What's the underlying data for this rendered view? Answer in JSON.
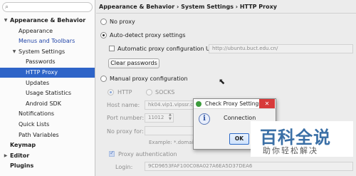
{
  "sidebar": {
    "search_placeholder": "",
    "items": [
      {
        "label": "Appearance & Behavior",
        "level": 0,
        "bold": true,
        "expanded": true
      },
      {
        "label": "Appearance",
        "level": 1
      },
      {
        "label": "Menus and Toolbars",
        "level": 1,
        "link": true
      },
      {
        "label": "System Settings",
        "level": 1,
        "expanded": true
      },
      {
        "label": "Passwords",
        "level": 2
      },
      {
        "label": "HTTP Proxy",
        "level": 2,
        "selected": true
      },
      {
        "label": "Updates",
        "level": 2
      },
      {
        "label": "Usage Statistics",
        "level": 2
      },
      {
        "label": "Android SDK",
        "level": 2
      },
      {
        "label": "Notifications",
        "level": 1
      },
      {
        "label": "Quick Lists",
        "level": 1
      },
      {
        "label": "Path Variables",
        "level": 1
      },
      {
        "label": "Keymap",
        "level": 0,
        "bold": true
      },
      {
        "label": "Editor",
        "level": 0,
        "bold": true,
        "collapsed": true
      },
      {
        "label": "Plugins",
        "level": 0,
        "bold": true
      }
    ]
  },
  "content": {
    "breadcrumb": "Appearance & Behavior › System Settings › HTTP Proxy",
    "no_proxy": "No proxy",
    "auto_detect": "Auto-detect proxy settings",
    "auto_config_label": "Automatic proxy configuration URL:",
    "auto_config_value": "http://ubuntu.buct.edu.cn/",
    "clear_passwords": "Clear passwords",
    "manual": "Manual proxy configuration",
    "http": "HTTP",
    "socks": "SOCKS",
    "host_label": "Host name:",
    "host_value": "hk04.vip1.vipssr.co",
    "port_label": "Port number:",
    "port_value": "11012",
    "no_proxy_for": "No proxy for:",
    "example": "Example: *.domain.co",
    "proxy_auth": "Proxy authentication",
    "login_label": "Login:",
    "login_value": "9CD9653FAF100C08A027A6EA5D37DEA6"
  },
  "dialog": {
    "title": "Check Proxy Settings",
    "message": "Connection",
    "ok": "OK"
  },
  "watermark": {
    "title": "百科全说",
    "subtitle": "助你轻松解决"
  }
}
